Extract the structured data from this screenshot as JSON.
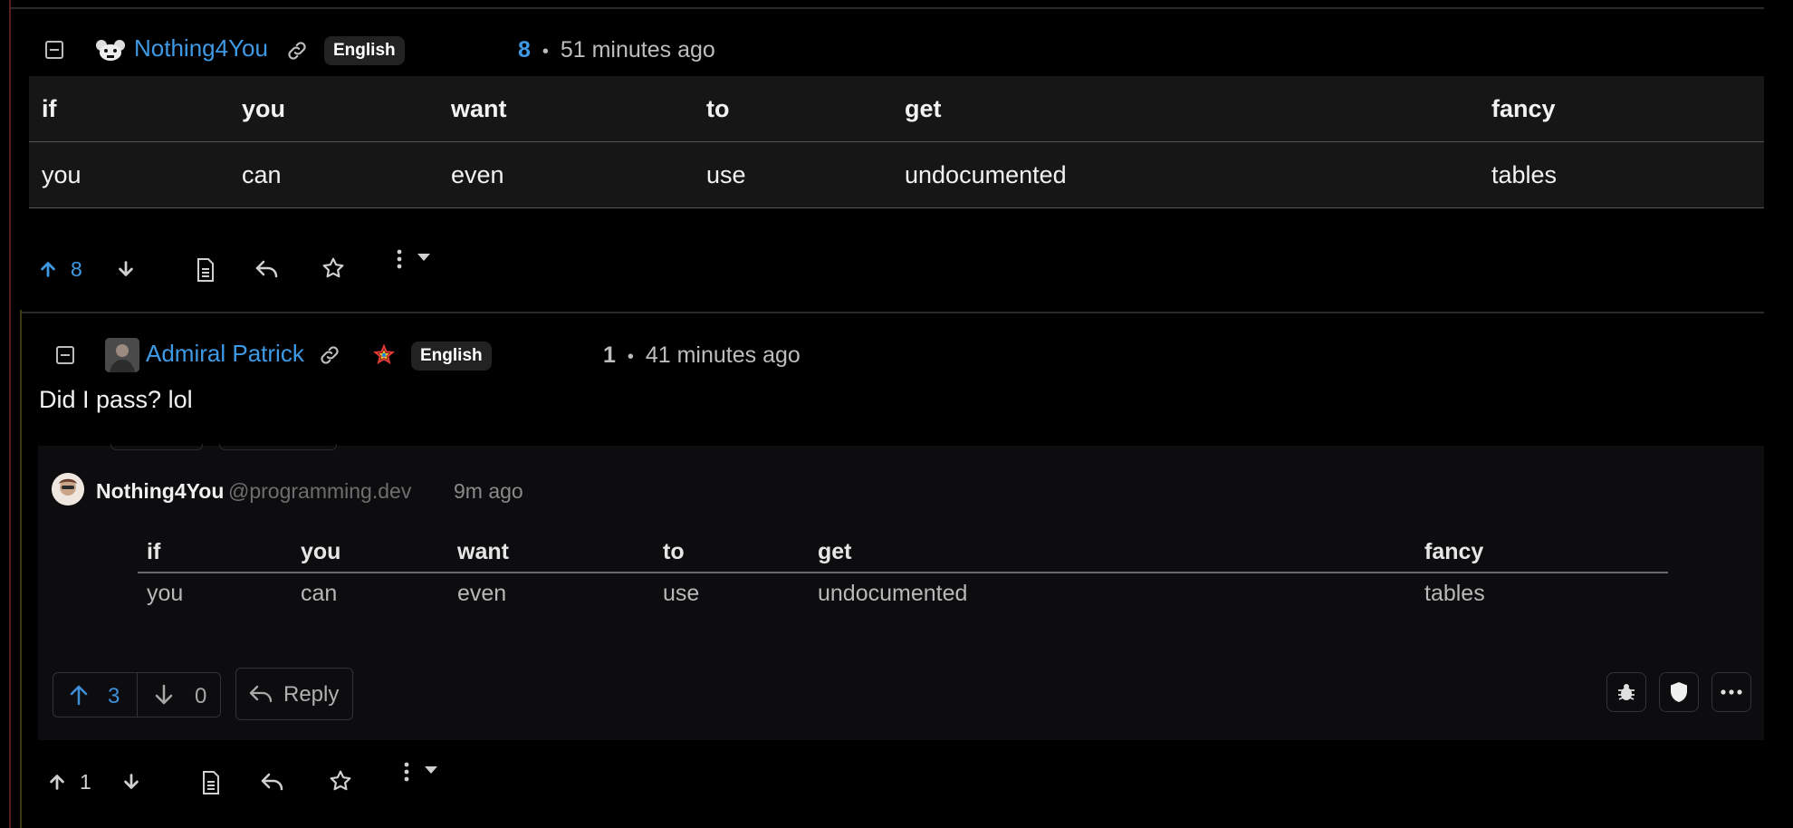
{
  "comment1": {
    "username": "Nothing4You",
    "language": "English",
    "score": "8",
    "separator": "•",
    "time": "51 minutes ago",
    "table": {
      "headers": [
        "if",
        "you",
        "want",
        "to",
        "get",
        "fancy"
      ],
      "row": [
        "you",
        "can",
        "even",
        "use",
        "undocumented",
        "tables"
      ]
    },
    "upvotes": "8"
  },
  "comment2": {
    "username": "Admiral Patrick",
    "language": "English",
    "score": "1",
    "separator": "•",
    "time": "41 minutes ago",
    "body": "Did I pass? lol",
    "upvotes": "1",
    "embed": {
      "username": "Nothing4You",
      "instance": "@programming.dev",
      "time": "9m ago",
      "table": {
        "headers": [
          "if",
          "you",
          "want",
          "to",
          "get",
          "fancy"
        ],
        "row": [
          "you",
          "can",
          "even",
          "use",
          "undocumented",
          "tables"
        ]
      },
      "upvotes": "3",
      "downvotes": "0",
      "reply_label": "Reply"
    }
  },
  "colors": {
    "accent": "#3f9ae6",
    "background": "#000000",
    "thread_line_outer": "#5a1e22",
    "thread_line_inner": "#3a3a14"
  },
  "icons": [
    "collapse-icon",
    "link-icon",
    "bot-avatar-icon",
    "upvote-icon",
    "downvote-icon",
    "view-source-icon",
    "reply-icon",
    "star-icon",
    "more-icon",
    "caret-down-icon",
    "user-avatar",
    "pride-flag-icon",
    "bug-icon",
    "shield-icon",
    "ellipsis-icon"
  ]
}
